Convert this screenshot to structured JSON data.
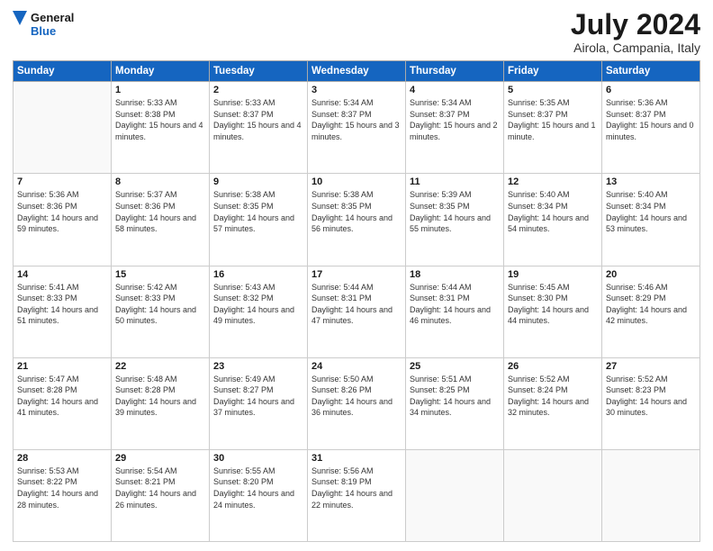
{
  "logo": {
    "line1": "General",
    "line2": "Blue"
  },
  "title": "July 2024",
  "subtitle": "Airola, Campania, Italy",
  "weekdays": [
    "Sunday",
    "Monday",
    "Tuesday",
    "Wednesday",
    "Thursday",
    "Friday",
    "Saturday"
  ],
  "weeks": [
    [
      {
        "day": "",
        "sunrise": "",
        "sunset": "",
        "daylight": ""
      },
      {
        "day": "1",
        "sunrise": "Sunrise: 5:33 AM",
        "sunset": "Sunset: 8:38 PM",
        "daylight": "Daylight: 15 hours and 4 minutes."
      },
      {
        "day": "2",
        "sunrise": "Sunrise: 5:33 AM",
        "sunset": "Sunset: 8:37 PM",
        "daylight": "Daylight: 15 hours and 4 minutes."
      },
      {
        "day": "3",
        "sunrise": "Sunrise: 5:34 AM",
        "sunset": "Sunset: 8:37 PM",
        "daylight": "Daylight: 15 hours and 3 minutes."
      },
      {
        "day": "4",
        "sunrise": "Sunrise: 5:34 AM",
        "sunset": "Sunset: 8:37 PM",
        "daylight": "Daylight: 15 hours and 2 minutes."
      },
      {
        "day": "5",
        "sunrise": "Sunrise: 5:35 AM",
        "sunset": "Sunset: 8:37 PM",
        "daylight": "Daylight: 15 hours and 1 minute."
      },
      {
        "day": "6",
        "sunrise": "Sunrise: 5:36 AM",
        "sunset": "Sunset: 8:37 PM",
        "daylight": "Daylight: 15 hours and 0 minutes."
      }
    ],
    [
      {
        "day": "7",
        "sunrise": "Sunrise: 5:36 AM",
        "sunset": "Sunset: 8:36 PM",
        "daylight": "Daylight: 14 hours and 59 minutes."
      },
      {
        "day": "8",
        "sunrise": "Sunrise: 5:37 AM",
        "sunset": "Sunset: 8:36 PM",
        "daylight": "Daylight: 14 hours and 58 minutes."
      },
      {
        "day": "9",
        "sunrise": "Sunrise: 5:38 AM",
        "sunset": "Sunset: 8:35 PM",
        "daylight": "Daylight: 14 hours and 57 minutes."
      },
      {
        "day": "10",
        "sunrise": "Sunrise: 5:38 AM",
        "sunset": "Sunset: 8:35 PM",
        "daylight": "Daylight: 14 hours and 56 minutes."
      },
      {
        "day": "11",
        "sunrise": "Sunrise: 5:39 AM",
        "sunset": "Sunset: 8:35 PM",
        "daylight": "Daylight: 14 hours and 55 minutes."
      },
      {
        "day": "12",
        "sunrise": "Sunrise: 5:40 AM",
        "sunset": "Sunset: 8:34 PM",
        "daylight": "Daylight: 14 hours and 54 minutes."
      },
      {
        "day": "13",
        "sunrise": "Sunrise: 5:40 AM",
        "sunset": "Sunset: 8:34 PM",
        "daylight": "Daylight: 14 hours and 53 minutes."
      }
    ],
    [
      {
        "day": "14",
        "sunrise": "Sunrise: 5:41 AM",
        "sunset": "Sunset: 8:33 PM",
        "daylight": "Daylight: 14 hours and 51 minutes."
      },
      {
        "day": "15",
        "sunrise": "Sunrise: 5:42 AM",
        "sunset": "Sunset: 8:33 PM",
        "daylight": "Daylight: 14 hours and 50 minutes."
      },
      {
        "day": "16",
        "sunrise": "Sunrise: 5:43 AM",
        "sunset": "Sunset: 8:32 PM",
        "daylight": "Daylight: 14 hours and 49 minutes."
      },
      {
        "day": "17",
        "sunrise": "Sunrise: 5:44 AM",
        "sunset": "Sunset: 8:31 PM",
        "daylight": "Daylight: 14 hours and 47 minutes."
      },
      {
        "day": "18",
        "sunrise": "Sunrise: 5:44 AM",
        "sunset": "Sunset: 8:31 PM",
        "daylight": "Daylight: 14 hours and 46 minutes."
      },
      {
        "day": "19",
        "sunrise": "Sunrise: 5:45 AM",
        "sunset": "Sunset: 8:30 PM",
        "daylight": "Daylight: 14 hours and 44 minutes."
      },
      {
        "day": "20",
        "sunrise": "Sunrise: 5:46 AM",
        "sunset": "Sunset: 8:29 PM",
        "daylight": "Daylight: 14 hours and 42 minutes."
      }
    ],
    [
      {
        "day": "21",
        "sunrise": "Sunrise: 5:47 AM",
        "sunset": "Sunset: 8:28 PM",
        "daylight": "Daylight: 14 hours and 41 minutes."
      },
      {
        "day": "22",
        "sunrise": "Sunrise: 5:48 AM",
        "sunset": "Sunset: 8:28 PM",
        "daylight": "Daylight: 14 hours and 39 minutes."
      },
      {
        "day": "23",
        "sunrise": "Sunrise: 5:49 AM",
        "sunset": "Sunset: 8:27 PM",
        "daylight": "Daylight: 14 hours and 37 minutes."
      },
      {
        "day": "24",
        "sunrise": "Sunrise: 5:50 AM",
        "sunset": "Sunset: 8:26 PM",
        "daylight": "Daylight: 14 hours and 36 minutes."
      },
      {
        "day": "25",
        "sunrise": "Sunrise: 5:51 AM",
        "sunset": "Sunset: 8:25 PM",
        "daylight": "Daylight: 14 hours and 34 minutes."
      },
      {
        "day": "26",
        "sunrise": "Sunrise: 5:52 AM",
        "sunset": "Sunset: 8:24 PM",
        "daylight": "Daylight: 14 hours and 32 minutes."
      },
      {
        "day": "27",
        "sunrise": "Sunrise: 5:52 AM",
        "sunset": "Sunset: 8:23 PM",
        "daylight": "Daylight: 14 hours and 30 minutes."
      }
    ],
    [
      {
        "day": "28",
        "sunrise": "Sunrise: 5:53 AM",
        "sunset": "Sunset: 8:22 PM",
        "daylight": "Daylight: 14 hours and 28 minutes."
      },
      {
        "day": "29",
        "sunrise": "Sunrise: 5:54 AM",
        "sunset": "Sunset: 8:21 PM",
        "daylight": "Daylight: 14 hours and 26 minutes."
      },
      {
        "day": "30",
        "sunrise": "Sunrise: 5:55 AM",
        "sunset": "Sunset: 8:20 PM",
        "daylight": "Daylight: 14 hours and 24 minutes."
      },
      {
        "day": "31",
        "sunrise": "Sunrise: 5:56 AM",
        "sunset": "Sunset: 8:19 PM",
        "daylight": "Daylight: 14 hours and 22 minutes."
      },
      {
        "day": "",
        "sunrise": "",
        "sunset": "",
        "daylight": ""
      },
      {
        "day": "",
        "sunrise": "",
        "sunset": "",
        "daylight": ""
      },
      {
        "day": "",
        "sunrise": "",
        "sunset": "",
        "daylight": ""
      }
    ]
  ]
}
